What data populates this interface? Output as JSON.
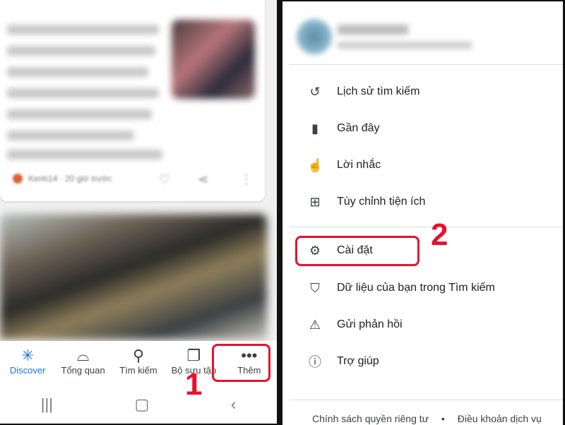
{
  "left": {
    "card": {
      "source": "Kenh14 · 20 giờ trước"
    },
    "bottom_nav": [
      {
        "label": "Discover",
        "icon": "discover-icon",
        "active": true
      },
      {
        "label": "Tổng quan",
        "icon": "snapshot-icon"
      },
      {
        "label": "Tìm kiếm",
        "icon": "search-icon"
      },
      {
        "label": "Bộ sưu tập",
        "icon": "collections-icon"
      },
      {
        "label": "Thêm",
        "icon": "more-icon"
      }
    ],
    "step_label": "1"
  },
  "right": {
    "menu": [
      {
        "label": "Lịch sử tìm kiếm",
        "icon": "history-icon"
      },
      {
        "label": "Gần đây",
        "icon": "recent-icon"
      },
      {
        "label": "Lời nhắc",
        "icon": "reminder-icon"
      },
      {
        "label": "Tùy chỉnh tiện ích",
        "icon": "widgets-icon"
      },
      {
        "label": "Cài đặt",
        "icon": "gear-icon"
      },
      {
        "label": "Dữ liệu của bạn trong Tìm kiếm",
        "icon": "shield-icon"
      },
      {
        "label": "Gửi phản hồi",
        "icon": "feedback-icon"
      },
      {
        "label": "Trợ giúp",
        "icon": "help-icon"
      }
    ],
    "step_label": "2",
    "footer": {
      "privacy": "Chính sách quyền riêng tư",
      "dot": "•",
      "terms": "Điều khoản dịch vụ"
    }
  },
  "colors": {
    "accent": "#1a73e8",
    "highlight": "#e8112d"
  }
}
